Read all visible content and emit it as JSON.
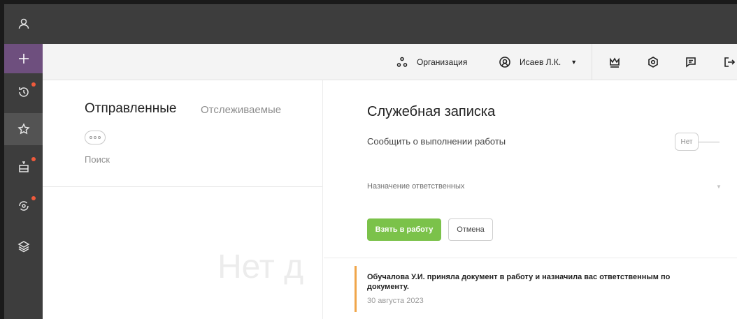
{
  "toolbar": {
    "organization_label": "Организация",
    "user_label": "Исаев Л.К."
  },
  "list": {
    "tabs": [
      {
        "label": "Отправленные",
        "active": true
      },
      {
        "label": "Отслеживаемые",
        "active": false
      }
    ],
    "search_label": "Поиск",
    "empty_text": "Нет д"
  },
  "detail": {
    "title": "Служебная записка",
    "notify_label": "Сообщить о выполнении работы",
    "notify_toggle": "Нет",
    "assign_label": "Назначение ответственных",
    "take_button": "Взять в работу",
    "cancel_button": "Отмена",
    "event": {
      "text": "Обучалова У.И. приняла документ в работу и назначила вас ответственным по документу.",
      "date": "30 августа 2023"
    }
  },
  "rail": {
    "icons": [
      "user-icon",
      "plus-icon",
      "history-icon",
      "star-icon",
      "inbox-icon",
      "eye-refresh-icon",
      "layers-icon"
    ]
  },
  "colors": {
    "rail_bg": "#3d3d3d",
    "accent_purple": "#6e4f7e",
    "primary_green": "#7bc24a",
    "badge_red": "#ef5a3c",
    "event_orange": "#f0a64a"
  }
}
